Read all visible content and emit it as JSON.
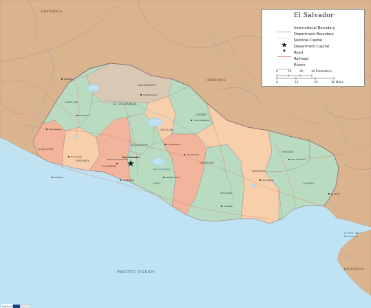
{
  "map": {
    "title": "El Salvador",
    "ocean_label": "PACIFIC OCEAN",
    "gulf_label_line1": "Golfo de",
    "gulf_label_line2": "Fonseca",
    "countries": {
      "guatemala": "GUATEMALA",
      "el_salvador": "EL SALVADOR",
      "honduras": "HONDURAS",
      "nicaragua": "NICARAGUA"
    },
    "capital": "San Salvador",
    "lake_ilopango": "Lago de Ilopango",
    "departments": [
      "AHUACHAPÁN",
      "SONSONATE",
      "SANTA ANA",
      "LA LIBERTAD",
      "CHALATENANGO",
      "CUSCATLÁN",
      "LA PAZ",
      "CABAÑAS",
      "SAN VICENTE",
      "USULUTÁN",
      "SAN MIGUEL",
      "MORAZÁN",
      "LA UNIÓN",
      "SAN SALVADOR"
    ],
    "cities": [
      "Ahuachapán",
      "Santa Ana",
      "Sonsonate",
      "Acajutla",
      "La Libertad",
      "Nueva San Salvador",
      "Chalatenango",
      "Cojutepeque",
      "Zacatecoluca",
      "Sensuntepeque",
      "San Vicente",
      "Usulután",
      "San Miguel",
      "San Francisco",
      "La Unión",
      "Metapán"
    ]
  },
  "legend": {
    "title": "El Salvador",
    "items": [
      {
        "symbol": "international-boundary",
        "label": "International Boundary"
      },
      {
        "symbol": "department-boundary",
        "label": "Department Boundary"
      },
      {
        "symbol": "national-capital",
        "label": "National Capital"
      },
      {
        "symbol": "department-capital",
        "label": "Department Capital"
      },
      {
        "symbol": "road",
        "label": "Road"
      },
      {
        "symbol": "railroad",
        "label": "Railroad"
      },
      {
        "symbol": "rivers",
        "label": "Rivers"
      }
    ],
    "scale": {
      "km_ticks": [
        "0",
        "10",
        "20",
        "30 Kilometers"
      ],
      "mile_ticks": [
        "0",
        "10",
        "20",
        "30 Miles"
      ]
    }
  },
  "publisher": {
    "brand": "MapResources"
  },
  "colors": {
    "ocean": "#bfe3f2",
    "neighbors": "#d9b48f",
    "green": "#b9dcc0",
    "peach": "#f7cfaa",
    "salmon": "#f2b59c",
    "tan": "#d8c8b4",
    "road": "#d98a7a",
    "boundary": "#9a7a8a"
  }
}
